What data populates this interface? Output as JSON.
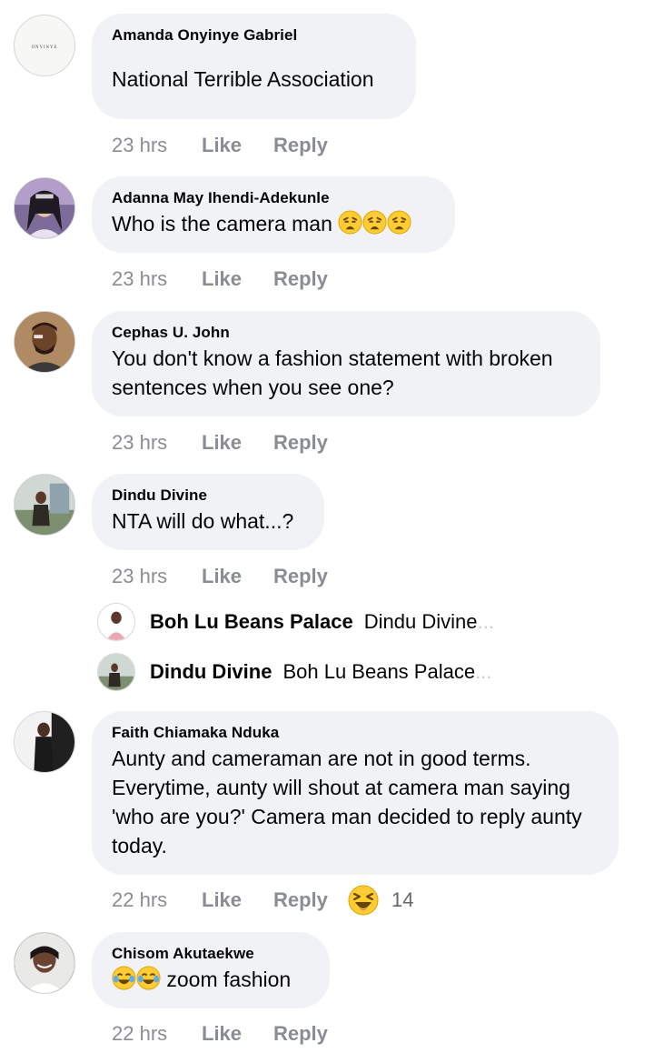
{
  "comments": [
    {
      "author": "Amanda Onyinye Gabriel",
      "avatar_text": "ONYINYE",
      "text": "National Terrible Association",
      "time": "23 hrs",
      "like_label": "Like",
      "reply_label": "Reply"
    },
    {
      "author": "Adanna May Ihendi-Adekunle",
      "text": "Who is the camera man",
      "emoji": [
        "weary-face",
        "weary-face",
        "weary-face"
      ],
      "time": "23 hrs",
      "like_label": "Like",
      "reply_label": "Reply"
    },
    {
      "author": "Cephas U. John",
      "text": "You don't know a fashion statement with broken sentences when you see one?",
      "text_lines": [
        "You don't know a fashion statement with broken",
        "sentences when you see one?"
      ],
      "time": "23 hrs",
      "like_label": "Like",
      "reply_label": "Reply"
    },
    {
      "author": "Dindu Divine",
      "text": "NTA will do what...?",
      "time": "23 hrs",
      "like_label": "Like",
      "reply_label": "Reply",
      "replies": [
        {
          "author": "Boh Lu Beans Palace",
          "preview": "Dindu Divine",
          "ellipsis": "..."
        },
        {
          "author": "Dindu Divine",
          "preview": "Boh Lu Beans Palace",
          "ellipsis": "..."
        }
      ]
    },
    {
      "author": "Faith Chiamaka Nduka",
      "text_lines": [
        "Aunty and cameraman are not in good terms.",
        "Everytime, aunty will shout at camera man saying",
        "'who are you?' Camera man decided to reply aunty",
        "today."
      ],
      "time": "22 hrs",
      "like_label": "Like",
      "reply_label": "Reply",
      "reaction": {
        "icon": "laughing-squint-face",
        "count": "14"
      }
    },
    {
      "author": "Chisom Akutaekwe",
      "emoji": [
        "tears-of-joy-face",
        "tears-of-joy-face"
      ],
      "text": "zoom fashion",
      "time": "22 hrs",
      "like_label": "Like",
      "reply_label": "Reply"
    }
  ],
  "colors": {
    "bubble": "#f0f2f5",
    "meta": "#8a8d91",
    "text": "#050505",
    "emoji_yellow": "#ffcc33"
  }
}
